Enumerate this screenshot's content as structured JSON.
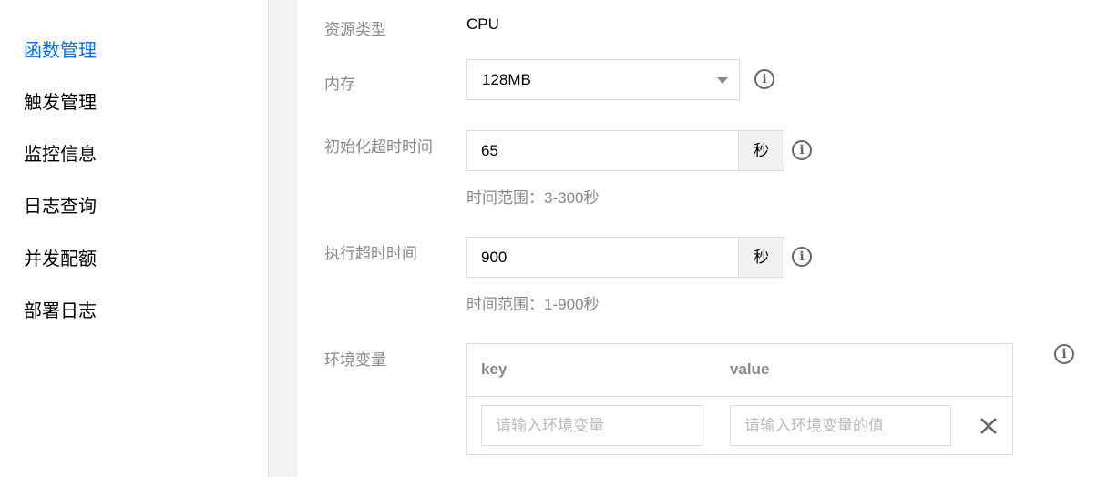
{
  "sidebar": {
    "items": [
      {
        "label": "函数管理",
        "active": true
      },
      {
        "label": "触发管理",
        "active": false
      },
      {
        "label": "监控信息",
        "active": false
      },
      {
        "label": "日志查询",
        "active": false
      },
      {
        "label": "并发配额",
        "active": false
      },
      {
        "label": "部署日志",
        "active": false
      }
    ]
  },
  "form": {
    "resource_type": {
      "label": "资源类型",
      "value": "CPU"
    },
    "memory": {
      "label": "内存",
      "value": "128MB",
      "icon": "info-icon"
    },
    "init_timeout": {
      "label": "初始化超时时间",
      "value": "65",
      "unit": "秒",
      "hint": "时间范围：3-300秒",
      "icon": "info-icon"
    },
    "exec_timeout": {
      "label": "执行超时时间",
      "value": "900",
      "unit": "秒",
      "hint": "时间范围：1-900秒",
      "icon": "info-icon"
    },
    "env": {
      "label": "环境变量",
      "key_header": "key",
      "value_header": "value",
      "key_placeholder": "请输入环境变量",
      "value_placeholder": "请输入环境变量的值",
      "icon": "info-icon"
    }
  },
  "colors": {
    "accent": "#006eff",
    "label": "#888888",
    "border": "#dddddd",
    "addon_bg": "#f0f1f3"
  }
}
